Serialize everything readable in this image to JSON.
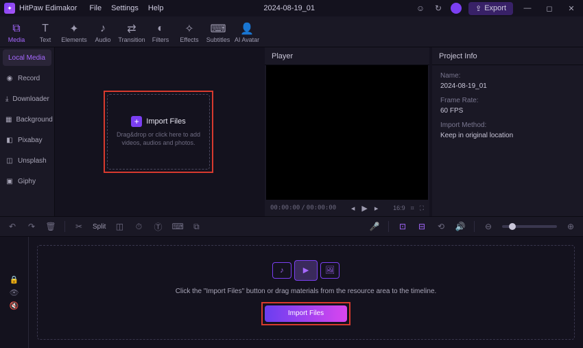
{
  "titlebar": {
    "app_name": "HitPaw Edimakor",
    "menu": [
      "File",
      "Settings",
      "Help"
    ],
    "project_name": "2024-08-19_01",
    "export_label": "Export"
  },
  "toolbar": [
    {
      "id": "media",
      "label": "Media",
      "icon": "⧉",
      "active": true
    },
    {
      "id": "text",
      "label": "Text",
      "icon": "T"
    },
    {
      "id": "elements",
      "label": "Elements",
      "icon": "✦"
    },
    {
      "id": "audio",
      "label": "Audio",
      "icon": "♪"
    },
    {
      "id": "transition",
      "label": "Transition",
      "icon": "⇄"
    },
    {
      "id": "filters",
      "label": "Filters",
      "icon": "◐"
    },
    {
      "id": "effects",
      "label": "Effects",
      "icon": "✧"
    },
    {
      "id": "subtitles",
      "label": "Subtitles",
      "icon": "⌨"
    },
    {
      "id": "aiavatar",
      "label": "AI Avatar",
      "icon": "👤"
    }
  ],
  "sidebar": [
    {
      "id": "local",
      "label": "Local Media",
      "icon": "",
      "active": true
    },
    {
      "id": "record",
      "label": "Record",
      "icon": "◉"
    },
    {
      "id": "downloader",
      "label": "Downloader",
      "icon": "⤓"
    },
    {
      "id": "background",
      "label": "Background",
      "icon": "▦"
    },
    {
      "id": "pixabay",
      "label": "Pixabay",
      "icon": "◧"
    },
    {
      "id": "unsplash",
      "label": "Unsplash",
      "icon": "◫"
    },
    {
      "id": "giphy",
      "label": "Giphy",
      "icon": "▣"
    }
  ],
  "import_box": {
    "title": "Import Files",
    "hint": "Drag&drop or click here to add videos, audios and photos."
  },
  "player": {
    "title": "Player",
    "time_current": "00:00:00",
    "time_total": "00:00:00",
    "aspect": "16:9"
  },
  "project_info": {
    "title": "Project Info",
    "name_label": "Name:",
    "name_value": "2024-08-19_01",
    "framerate_label": "Frame Rate:",
    "framerate_value": "60 FPS",
    "importmethod_label": "Import Method:",
    "importmethod_value": "Keep in original location"
  },
  "tl_toolbar": {
    "split_label": "Split"
  },
  "timeline": {
    "hint": "Click the \"Import Files\" button or drag materials from the resource area to the timeline.",
    "button_label": "Import Files"
  }
}
